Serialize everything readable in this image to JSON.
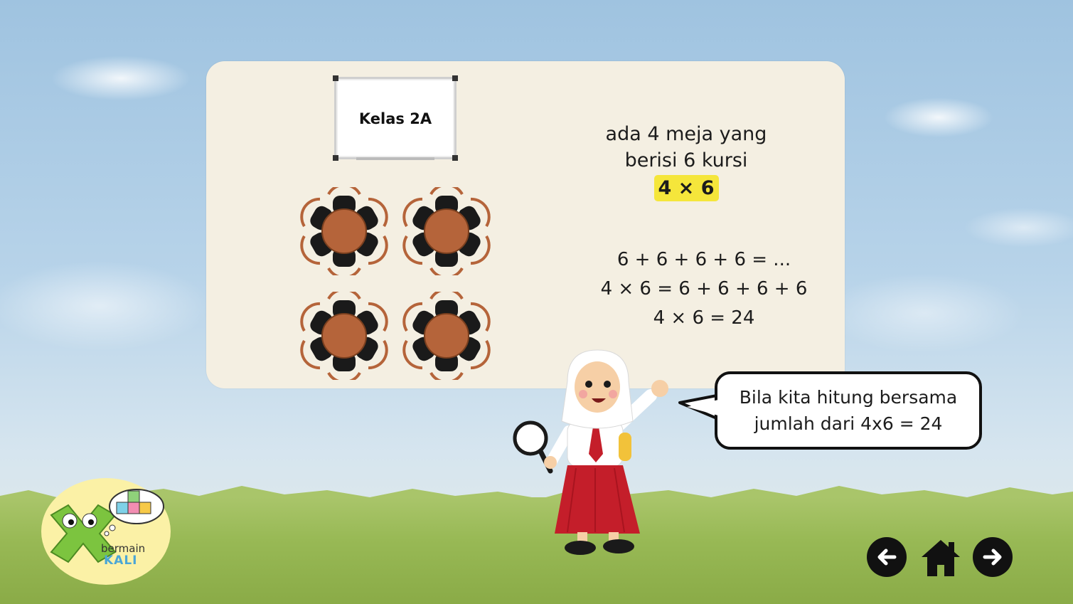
{
  "board": {
    "title": "Kelas 2A"
  },
  "story": {
    "line1": "ada 4 meja yang",
    "line2": "berisi 6 kursi",
    "highlight": "4 × 6"
  },
  "equations": [
    "6 + 6 + 6 + 6 = ...",
    "4 × 6 = 6 + 6 + 6 + 6",
    "4 × 6 = 24"
  ],
  "speech": {
    "line1": "Bila kita hitung bersama",
    "line2": "jumlah dari 4x6 = 24"
  },
  "logo": {
    "word1": "bermain",
    "word2": "KALI"
  },
  "nav": {
    "back_icon": "arrow-left-icon",
    "home_icon": "home-icon",
    "next_icon": "arrow-right-icon"
  },
  "colors": {
    "highlight": "#f5e63b",
    "table": "#b5643a",
    "chair": "#1a1a1a",
    "panel": "#f4efe2",
    "button": "#111111"
  }
}
